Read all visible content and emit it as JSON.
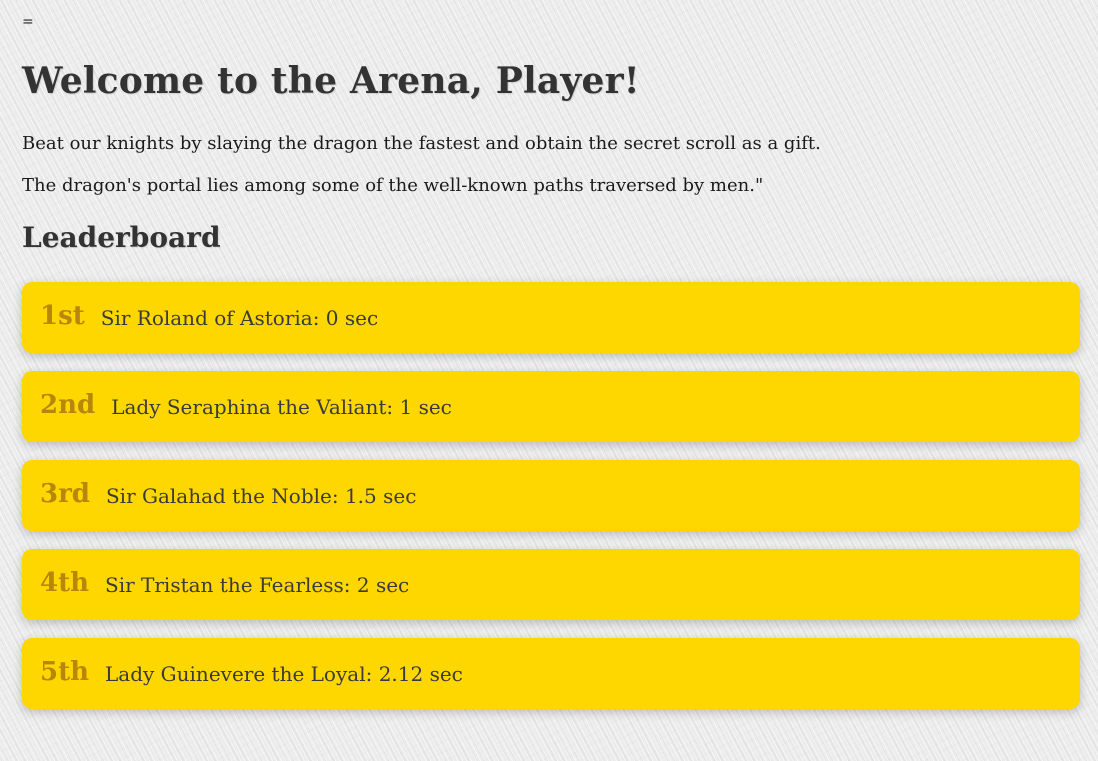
{
  "page": {
    "stray_text": "=",
    "title": "Welcome to the Arena, Player!",
    "intro_lines": [
      "Beat our knights by slaying the dragon the fastest and obtain the secret scroll as a gift.",
      "The dragon's portal lies among some of the well-known paths traversed by men.\""
    ]
  },
  "leaderboard": {
    "heading": "Leaderboard",
    "entries": [
      {
        "rank": "1st",
        "text": "Sir Roland of Astoria: 0 sec"
      },
      {
        "rank": "2nd",
        "text": "Lady Seraphina the Valiant: 1 sec"
      },
      {
        "rank": "3rd",
        "text": "Sir Galahad the Noble: 1.5 sec"
      },
      {
        "rank": "4th",
        "text": "Sir Tristan the Fearless: 2 sec"
      },
      {
        "rank": "5th",
        "text": "Lady Guinevere the Loyal: 2.12 sec"
      }
    ]
  },
  "colors": {
    "card_background": "#ffd700",
    "rank_text": "#b8860b",
    "heading_text": "#333333",
    "page_background": "#ececec"
  }
}
